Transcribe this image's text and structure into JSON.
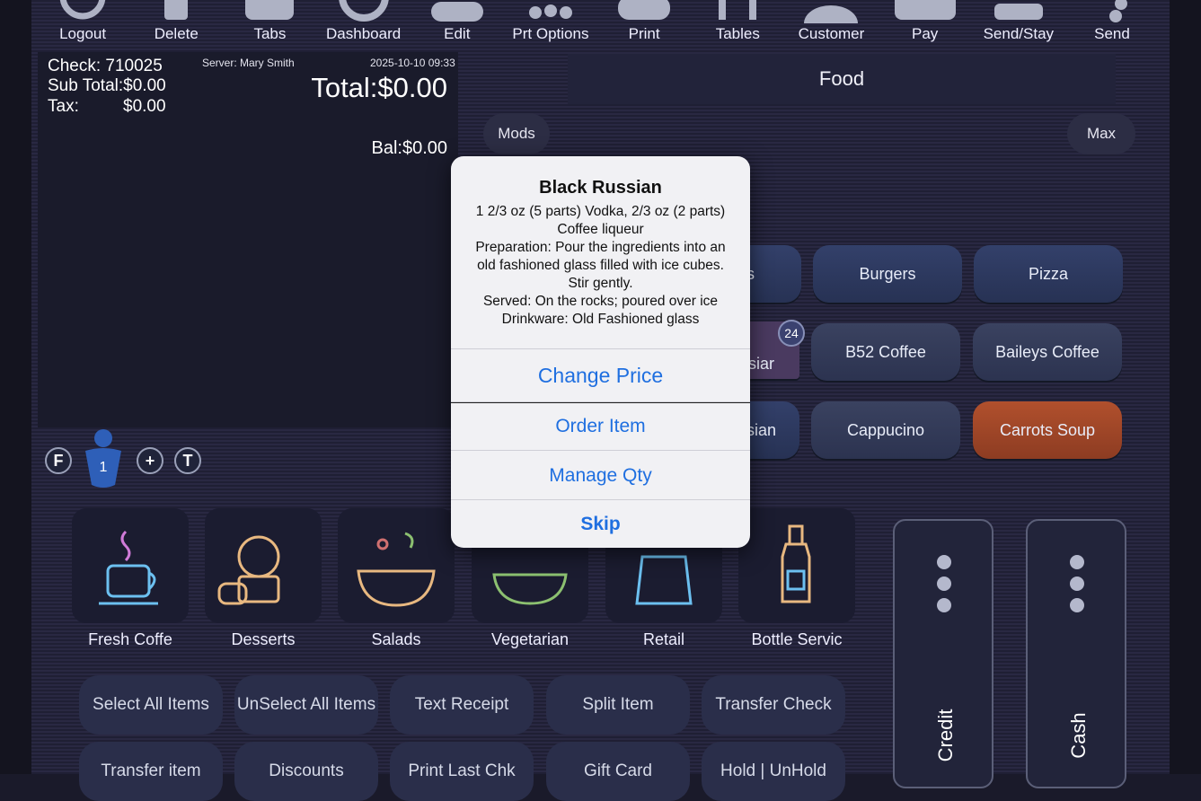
{
  "toolbar": {
    "items": [
      {
        "label": "Logout",
        "icon": "logout-icon"
      },
      {
        "label": "Delete",
        "icon": "trash-icon"
      },
      {
        "label": "Tabs",
        "icon": "tabs-icon"
      },
      {
        "label": "Dashboard",
        "icon": "dashboard-icon"
      },
      {
        "label": "Edit",
        "icon": "edit-icon"
      },
      {
        "label": "Prt Options",
        "icon": "print-options-icon"
      },
      {
        "label": "Print",
        "icon": "printer-icon"
      },
      {
        "label": "Tables",
        "icon": "tables-icon"
      },
      {
        "label": "Customer",
        "icon": "customer-icon"
      },
      {
        "label": "Pay",
        "icon": "pay-icon"
      },
      {
        "label": "Send/Stay",
        "icon": "send-stay-icon"
      },
      {
        "label": "Send",
        "icon": "send-icon"
      }
    ]
  },
  "check": {
    "check_line": "Check: 710025",
    "server": "Server: Mary Smith",
    "datetime": "2025-10-10 09:33",
    "subtotal": "Sub Total:$0.00",
    "tax_label": "Tax:",
    "tax_value": "$0.00",
    "total": "Total:$0.00",
    "balance": "Bal:$0.00"
  },
  "seat": {
    "left_button": "F",
    "seat_number": "1",
    "plus_button": "+",
    "right_button": "T"
  },
  "menu": {
    "category_title": "Food",
    "mods_label": "Mods",
    "max_label": "Max",
    "badge_count": "24",
    "items": {
      "partial_top": "s",
      "burgers": "Burgers",
      "pizza": "Pizza",
      "partial_mid": "siar",
      "b52": "B52 Coffee",
      "baileys": "Baileys Coffee",
      "partial_low": "sian",
      "cappucino": "Cappucino",
      "carrots_soup": "Carrots Soup"
    }
  },
  "categories": [
    {
      "label": "Fresh Coffe",
      "icon": "coffee-cup-icon"
    },
    {
      "label": "Desserts",
      "icon": "dessert-icon"
    },
    {
      "label": "Salads",
      "icon": "salad-bowl-icon"
    },
    {
      "label": "Vegetarian",
      "icon": "vegetarian-bowl-icon"
    },
    {
      "label": "Retail",
      "icon": "shopping-bag-icon"
    },
    {
      "label": "Bottle Servic",
      "icon": "bottle-icon"
    }
  ],
  "payment": {
    "credit": "Credit",
    "cash": "Cash"
  },
  "actions": {
    "row1": [
      "Select All Items",
      "UnSelect All Items",
      "Text Receipt",
      "Split Item",
      "Transfer Check"
    ],
    "row2": [
      "Transfer item",
      "Discounts",
      "Print Last Chk",
      "Gift Card",
      "Hold | UnHold"
    ]
  },
  "dialog": {
    "title": "Black Russian",
    "body": "1 2/3 oz (5 parts) Vodka, 2/3 oz (2 parts) Coffee liqueur\nPreparation: Pour the ingredients into an old fashioned glass filled with ice cubes. Stir gently.\nServed: On the rocks; poured over ice\nDrinkware: Old Fashioned glass",
    "change_price": "Change Price",
    "order_item": "Order Item",
    "manage_qty": "Manage Qty",
    "skip": "Skip"
  },
  "colors": {
    "accent_blue": "#1f6fe0",
    "item_orange": "#b1502d",
    "item_blue": "#33406a"
  }
}
